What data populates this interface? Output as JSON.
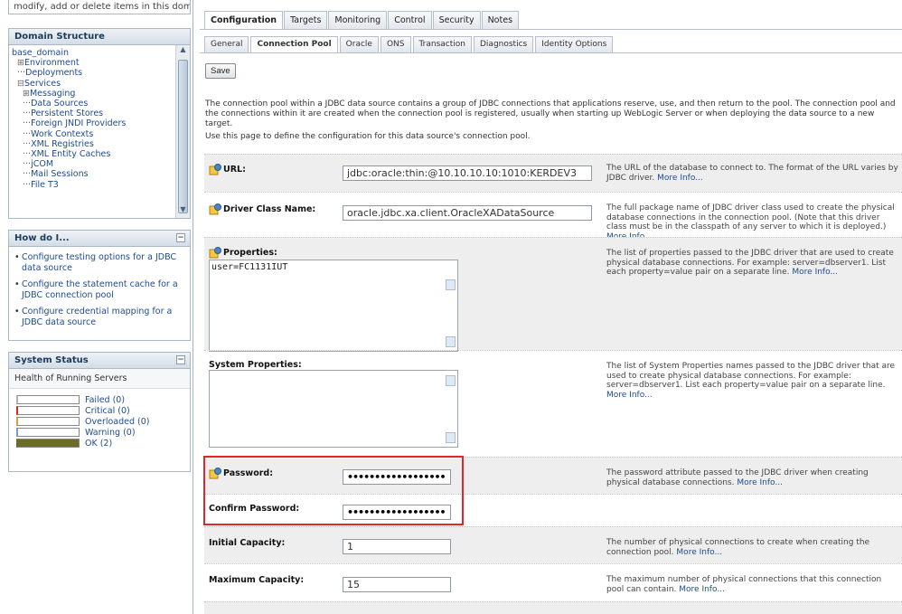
{
  "sidebar": {
    "top_text": "modify, add or delete items in this domain.",
    "domain_structure": {
      "title": "Domain Structure",
      "items": [
        {
          "label": "base_domain",
          "indent": 0,
          "prefix": ""
        },
        {
          "label": "Environment",
          "indent": 1,
          "prefix": "⊞"
        },
        {
          "label": "Deployments",
          "indent": 1,
          "prefix": "···"
        },
        {
          "label": "Services",
          "indent": 1,
          "prefix": "⊟"
        },
        {
          "label": "Messaging",
          "indent": 2,
          "prefix": "⊞"
        },
        {
          "label": "Data Sources",
          "indent": 2,
          "prefix": "···"
        },
        {
          "label": "Persistent Stores",
          "indent": 2,
          "prefix": "···"
        },
        {
          "label": "Foreign JNDI Providers",
          "indent": 2,
          "prefix": "···"
        },
        {
          "label": "Work Contexts",
          "indent": 2,
          "prefix": "···"
        },
        {
          "label": "XML Registries",
          "indent": 2,
          "prefix": "···"
        },
        {
          "label": "XML Entity Caches",
          "indent": 2,
          "prefix": "···"
        },
        {
          "label": "jCOM",
          "indent": 2,
          "prefix": "···"
        },
        {
          "label": "Mail Sessions",
          "indent": 2,
          "prefix": "···"
        },
        {
          "label": "File T3",
          "indent": 2,
          "prefix": "···"
        }
      ]
    },
    "how_do_i": {
      "title": "How do I...",
      "items": [
        "Configure testing options for a JDBC data source",
        "Configure the statement cache for a JDBC connection pool",
        "Configure credential mapping for a JDBC data source"
      ]
    },
    "system_status": {
      "title": "System Status",
      "subtitle": "Health of Running Servers",
      "rows": [
        {
          "label": "Failed (0)",
          "color": "#ffffff",
          "mark": "#b0b0b0"
        },
        {
          "label": "Critical (0)",
          "color": "#ffffff",
          "mark": "#d9262b"
        },
        {
          "label": "Overloaded (0)",
          "color": "#ffffff",
          "mark": "#d7a23a"
        },
        {
          "label": "Warning (0)",
          "color": "#ffffff",
          "mark": "#7a9fbe"
        },
        {
          "label": "OK (2)",
          "color": "#6b6b2a",
          "mark": "#6b6b2a"
        }
      ]
    }
  },
  "tabs_primary": [
    "Configuration",
    "Targets",
    "Monitoring",
    "Control",
    "Security",
    "Notes"
  ],
  "tabs_secondary": [
    "General",
    "Connection Pool",
    "Oracle",
    "ONS",
    "Transaction",
    "Diagnostics",
    "Identity Options"
  ],
  "save_label": "Save",
  "intro": "The connection pool within a JDBC data source contains a group of JDBC connections that applications reserve, use, and then return to the pool. The connection pool and the connections within it are created when the connection pool is registered, usually when starting up WebLogic Server or when deploying the data source to a new target.",
  "intro2": "Use this page to define the configuration for this data source's connection pool.",
  "more_info": "More Info...",
  "fields": {
    "url": {
      "label": "URL:",
      "value": "jdbc:oracle:thin:@10.10.10.10:1010:KERDEV3",
      "desc": "The URL of the database to connect to. The format of the URL varies by JDBC driver."
    },
    "driver": {
      "label": "Driver Class Name:",
      "value": "oracle.jdbc.xa.client.OracleXADataSource",
      "desc": "The full package name of JDBC driver class used to create the physical database connections in the connection pool. (Note that this driver class must be in the classpath of any server to which it is deployed.)"
    },
    "properties": {
      "label": "Properties:",
      "value": "user=FC1131IUT",
      "desc": "The list of properties passed to the JDBC driver that are used to create physical database connections. For example: server=dbserver1. List each property=value pair on a separate line."
    },
    "sys_properties": {
      "label": "System Properties:",
      "value": "",
      "desc": "The list of System Properties names passed to the JDBC driver that are used to create physical database connections. For example: server=dbserver1. List each property=value pair on a separate line."
    },
    "password": {
      "label": "Password:",
      "value": "••••••••••••••••••",
      "desc": "The password attribute passed to the JDBC driver when creating physical database connections."
    },
    "confirm_password": {
      "label": "Confirm Password:",
      "value": "••••••••••••••••••"
    },
    "initial_capacity": {
      "label": "Initial Capacity:",
      "value": "1",
      "desc": "The number of physical connections to create when creating the connection pool."
    },
    "max_capacity": {
      "label": "Maximum Capacity:",
      "value": "15",
      "desc": "The maximum number of physical connections that this connection pool can contain."
    }
  },
  "colors": {
    "highlight": "#e2262b",
    "link": "#1d4b8f"
  }
}
